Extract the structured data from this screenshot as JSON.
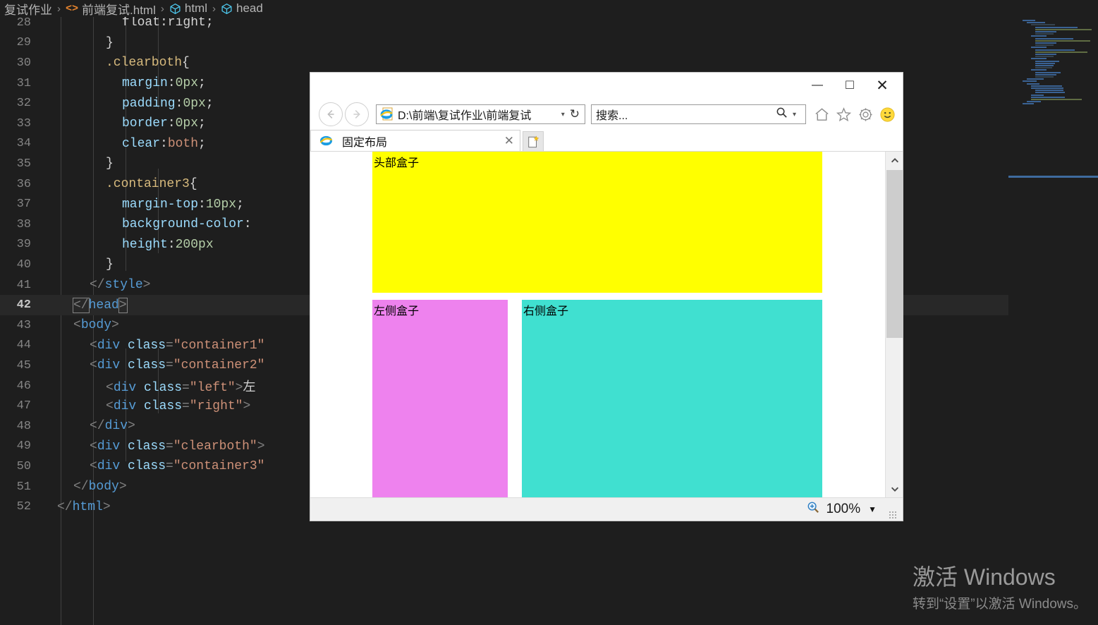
{
  "editor": {
    "breadcrumb": [
      {
        "label": "复试作业",
        "icon": ""
      },
      {
        "label": "前端复试.html",
        "icon": "code-icon"
      },
      {
        "label": "html",
        "icon": "cube-icon"
      },
      {
        "label": "head",
        "icon": "cube-icon"
      }
    ],
    "separator": "›",
    "active_line": 42,
    "lines": [
      {
        "n": 28,
        "tokens": [
          {
            "t": "float:right;",
            "c": "t-plain"
          }
        ],
        "indent": 5,
        "partial": true
      },
      {
        "n": 29,
        "tokens": [
          {
            "t": "}",
            "c": "t-punc"
          }
        ],
        "indent": 4
      },
      {
        "n": 30,
        "tokens": [
          {
            "t": ".clearboth",
            "c": "t-sel"
          },
          {
            "t": "{",
            "c": "t-punc"
          }
        ],
        "indent": 4
      },
      {
        "n": 31,
        "tokens": [
          {
            "t": "margin",
            "c": "t-prop"
          },
          {
            "t": ":",
            "c": "t-punc"
          },
          {
            "t": "0px",
            "c": "t-num"
          },
          {
            "t": ";",
            "c": "t-punc"
          }
        ],
        "indent": 5
      },
      {
        "n": 32,
        "tokens": [
          {
            "t": "padding",
            "c": "t-prop"
          },
          {
            "t": ":",
            "c": "t-punc"
          },
          {
            "t": "0px",
            "c": "t-num"
          },
          {
            "t": ";",
            "c": "t-punc"
          }
        ],
        "indent": 5
      },
      {
        "n": 33,
        "tokens": [
          {
            "t": "border",
            "c": "t-prop"
          },
          {
            "t": ":",
            "c": "t-punc"
          },
          {
            "t": "0px",
            "c": "t-num"
          },
          {
            "t": ";",
            "c": "t-punc"
          }
        ],
        "indent": 5
      },
      {
        "n": 34,
        "tokens": [
          {
            "t": "clear",
            "c": "t-prop"
          },
          {
            "t": ":",
            "c": "t-punc"
          },
          {
            "t": "both",
            "c": "t-val"
          },
          {
            "t": ";",
            "c": "t-punc"
          }
        ],
        "indent": 5
      },
      {
        "n": 35,
        "tokens": [
          {
            "t": "}",
            "c": "t-punc"
          }
        ],
        "indent": 4
      },
      {
        "n": 36,
        "tokens": [
          {
            "t": ".container3",
            "c": "t-sel"
          },
          {
            "t": "{",
            "c": "t-punc"
          }
        ],
        "indent": 4
      },
      {
        "n": 37,
        "tokens": [
          {
            "t": "margin-top",
            "c": "t-prop"
          },
          {
            "t": ":",
            "c": "t-punc"
          },
          {
            "t": "10px",
            "c": "t-num"
          },
          {
            "t": ";",
            "c": "t-punc"
          }
        ],
        "indent": 5
      },
      {
        "n": 38,
        "tokens": [
          {
            "t": "background-color",
            "c": "t-prop"
          },
          {
            "t": ":",
            "c": "t-punc"
          }
        ],
        "indent": 5
      },
      {
        "n": 39,
        "tokens": [
          {
            "t": "height",
            "c": "t-prop"
          },
          {
            "t": ":",
            "c": "t-punc"
          },
          {
            "t": "200px",
            "c": "t-num"
          }
        ],
        "indent": 5
      },
      {
        "n": 40,
        "tokens": [
          {
            "t": "}",
            "c": "t-punc"
          }
        ],
        "indent": 4
      },
      {
        "n": 41,
        "tokens": [
          {
            "t": "</",
            "c": "t-brk"
          },
          {
            "t": "style",
            "c": "t-tag"
          },
          {
            "t": ">",
            "c": "t-brk"
          }
        ],
        "indent": 3
      },
      {
        "n": 42,
        "tokens": [
          {
            "t": "</",
            "c": "t-brk bmatch"
          },
          {
            "t": "head",
            "c": "t-tag"
          },
          {
            "t": ">",
            "c": "t-brk bmatch"
          }
        ],
        "indent": 2
      },
      {
        "n": 43,
        "tokens": [
          {
            "t": "<",
            "c": "t-brk"
          },
          {
            "t": "body",
            "c": "t-tag"
          },
          {
            "t": ">",
            "c": "t-brk"
          }
        ],
        "indent": 2
      },
      {
        "n": 44,
        "tokens": [
          {
            "t": "<",
            "c": "t-brk"
          },
          {
            "t": "div",
            "c": "t-tag"
          },
          {
            "t": " ",
            "c": "t-plain"
          },
          {
            "t": "class",
            "c": "t-attr"
          },
          {
            "t": "=",
            "c": "t-brk"
          },
          {
            "t": "\"container1\"",
            "c": "t-str"
          }
        ],
        "indent": 3
      },
      {
        "n": 45,
        "tokens": [
          {
            "t": "<",
            "c": "t-brk"
          },
          {
            "t": "div",
            "c": "t-tag"
          },
          {
            "t": " ",
            "c": "t-plain"
          },
          {
            "t": "class",
            "c": "t-attr"
          },
          {
            "t": "=",
            "c": "t-brk"
          },
          {
            "t": "\"container2\"",
            "c": "t-str"
          }
        ],
        "indent": 3
      },
      {
        "n": 46,
        "tokens": [
          {
            "t": "<",
            "c": "t-brk"
          },
          {
            "t": "div",
            "c": "t-tag"
          },
          {
            "t": " ",
            "c": "t-plain"
          },
          {
            "t": "class",
            "c": "t-attr"
          },
          {
            "t": "=",
            "c": "t-brk"
          },
          {
            "t": "\"left\"",
            "c": "t-str"
          },
          {
            "t": ">",
            "c": "t-brk"
          },
          {
            "t": "左",
            "c": "t-plain"
          }
        ],
        "indent": 4
      },
      {
        "n": 47,
        "tokens": [
          {
            "t": "<",
            "c": "t-brk"
          },
          {
            "t": "div",
            "c": "t-tag"
          },
          {
            "t": " ",
            "c": "t-plain"
          },
          {
            "t": "class",
            "c": "t-attr"
          },
          {
            "t": "=",
            "c": "t-brk"
          },
          {
            "t": "\"right\"",
            "c": "t-str"
          },
          {
            "t": ">",
            "c": "t-brk"
          }
        ],
        "indent": 4
      },
      {
        "n": 48,
        "tokens": [
          {
            "t": "</",
            "c": "t-brk"
          },
          {
            "t": "div",
            "c": "t-tag"
          },
          {
            "t": ">",
            "c": "t-brk"
          }
        ],
        "indent": 3
      },
      {
        "n": 49,
        "tokens": [
          {
            "t": "<",
            "c": "t-brk"
          },
          {
            "t": "div",
            "c": "t-tag"
          },
          {
            "t": " ",
            "c": "t-plain"
          },
          {
            "t": "class",
            "c": "t-attr"
          },
          {
            "t": "=",
            "c": "t-brk"
          },
          {
            "t": "\"clearboth\"",
            "c": "t-str"
          },
          {
            "t": ">",
            "c": "t-brk"
          }
        ],
        "indent": 3
      },
      {
        "n": 50,
        "tokens": [
          {
            "t": "<",
            "c": "t-brk"
          },
          {
            "t": "div",
            "c": "t-tag"
          },
          {
            "t": " ",
            "c": "t-plain"
          },
          {
            "t": "class",
            "c": "t-attr"
          },
          {
            "t": "=",
            "c": "t-brk"
          },
          {
            "t": "\"container3\"",
            "c": "t-str"
          }
        ],
        "indent": 3
      },
      {
        "n": 51,
        "tokens": [
          {
            "t": "</",
            "c": "t-brk"
          },
          {
            "t": "body",
            "c": "t-tag"
          },
          {
            "t": ">",
            "c": "t-brk"
          }
        ],
        "indent": 2
      },
      {
        "n": 52,
        "tokens": [
          {
            "t": "</",
            "c": "t-brk"
          },
          {
            "t": "html",
            "c": "t-tag"
          },
          {
            "t": ">",
            "c": "t-brk"
          }
        ],
        "indent": 1
      }
    ]
  },
  "browser": {
    "window_controls": {
      "minimize": "—",
      "maximize": "□",
      "close": "✕"
    },
    "back_label": "‹",
    "forward_label": "›",
    "address_value": "D:\\前端\\复试作业\\前端复试",
    "address_dropdown": "▾",
    "refresh_label": "↻",
    "search_placeholder": "搜索...",
    "search_dropdown": "▾",
    "toolbar_icons": [
      "home-icon",
      "favorites-star-icon",
      "settings-gear-icon",
      "feedback-smiley-icon"
    ],
    "tab": {
      "title": "固定布局",
      "close": "✕"
    },
    "new_tab_label": "",
    "zoom_level": "100%",
    "zoom_caret": "▼",
    "scrollbar": {
      "up": "⌃",
      "down": "⌄"
    }
  },
  "page": {
    "header_box": {
      "label": "头部盒子",
      "color": "#FFFF00"
    },
    "left_box": {
      "label": "左侧盒子",
      "color": "#EE82EE"
    },
    "right_box": {
      "label": "右侧盒子",
      "color": "#40E0D0"
    }
  },
  "watermark": {
    "title": "激活 Windows",
    "subtitle": "转到“设置”以激活 Windows。"
  }
}
